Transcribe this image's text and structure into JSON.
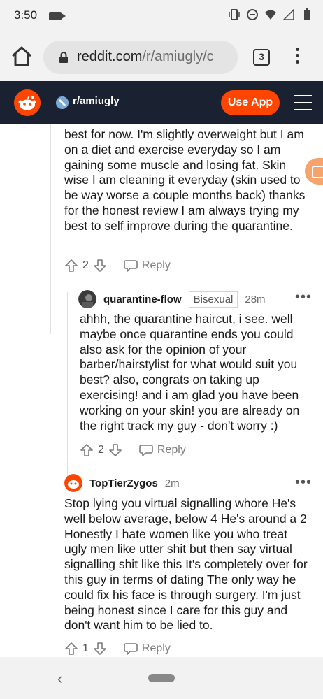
{
  "status_bar": {
    "time": "3:50"
  },
  "browser": {
    "url_domain": "reddit.com",
    "url_path": "/r/amiugly/c",
    "tab_count": "3"
  },
  "reddit_header": {
    "subreddit": "r/amiugly",
    "use_app_label": "Use App"
  },
  "comments": [
    {
      "body": "best for now. I'm slightly overweight but I am on a diet and exercise everyday so I am gaining some muscle and losing fat. Skin wise I am cleaning it everyday (skin used to be way worse a couple months back) thanks for the honest review I am always trying my best to self improve during the quarantine.",
      "votes": "2",
      "reply_label": "Reply"
    },
    {
      "username": "quarantine-flow",
      "flair": "Bisexual",
      "time": "28m",
      "body": "ahhh, the quarantine haircut, i see. well maybe once quarantine ends you could also ask for the opinion of your barber/hairstylist for what would suit you best? also, congrats on taking up exercising! and i am glad you have been working on your skin! you are already on the right track my guy - don't worry :)",
      "votes": "2",
      "reply_label": "Reply"
    },
    {
      "username": "TopTierZygos",
      "time": "2m",
      "body": "Stop lying you virtual signalling whore He's well below average, below 4 He's around a 2 Honestly I hate women like you who treat ugly men like utter shit but then say virtual signalling shit like this It's completely over for this guy in terms of dating The only way he could fix his face is through surgery. I'm just being honest since I care for this guy and don't want him to be lied to.",
      "votes": "1",
      "reply_label": "Reply"
    }
  ],
  "colors": {
    "reddit_orange": "#ff4500",
    "header_bg": "#1a2130"
  }
}
